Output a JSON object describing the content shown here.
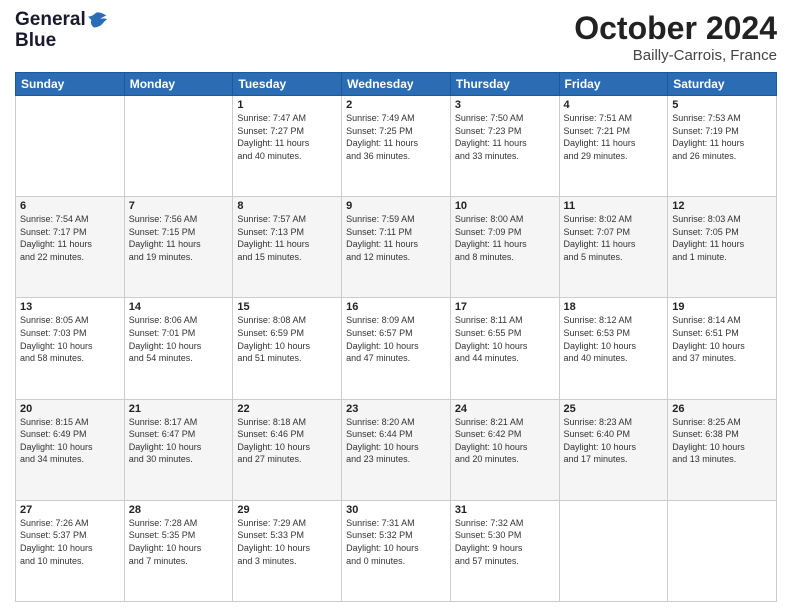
{
  "header": {
    "logo_line1": "General",
    "logo_line2": "Blue",
    "title": "October 2024",
    "location": "Bailly-Carrois, France"
  },
  "weekdays": [
    "Sunday",
    "Monday",
    "Tuesday",
    "Wednesday",
    "Thursday",
    "Friday",
    "Saturday"
  ],
  "weeks": [
    [
      {
        "day": "",
        "info": ""
      },
      {
        "day": "",
        "info": ""
      },
      {
        "day": "1",
        "info": "Sunrise: 7:47 AM\nSunset: 7:27 PM\nDaylight: 11 hours\nand 40 minutes."
      },
      {
        "day": "2",
        "info": "Sunrise: 7:49 AM\nSunset: 7:25 PM\nDaylight: 11 hours\nand 36 minutes."
      },
      {
        "day": "3",
        "info": "Sunrise: 7:50 AM\nSunset: 7:23 PM\nDaylight: 11 hours\nand 33 minutes."
      },
      {
        "day": "4",
        "info": "Sunrise: 7:51 AM\nSunset: 7:21 PM\nDaylight: 11 hours\nand 29 minutes."
      },
      {
        "day": "5",
        "info": "Sunrise: 7:53 AM\nSunset: 7:19 PM\nDaylight: 11 hours\nand 26 minutes."
      }
    ],
    [
      {
        "day": "6",
        "info": "Sunrise: 7:54 AM\nSunset: 7:17 PM\nDaylight: 11 hours\nand 22 minutes."
      },
      {
        "day": "7",
        "info": "Sunrise: 7:56 AM\nSunset: 7:15 PM\nDaylight: 11 hours\nand 19 minutes."
      },
      {
        "day": "8",
        "info": "Sunrise: 7:57 AM\nSunset: 7:13 PM\nDaylight: 11 hours\nand 15 minutes."
      },
      {
        "day": "9",
        "info": "Sunrise: 7:59 AM\nSunset: 7:11 PM\nDaylight: 11 hours\nand 12 minutes."
      },
      {
        "day": "10",
        "info": "Sunrise: 8:00 AM\nSunset: 7:09 PM\nDaylight: 11 hours\nand 8 minutes."
      },
      {
        "day": "11",
        "info": "Sunrise: 8:02 AM\nSunset: 7:07 PM\nDaylight: 11 hours\nand 5 minutes."
      },
      {
        "day": "12",
        "info": "Sunrise: 8:03 AM\nSunset: 7:05 PM\nDaylight: 11 hours\nand 1 minute."
      }
    ],
    [
      {
        "day": "13",
        "info": "Sunrise: 8:05 AM\nSunset: 7:03 PM\nDaylight: 10 hours\nand 58 minutes."
      },
      {
        "day": "14",
        "info": "Sunrise: 8:06 AM\nSunset: 7:01 PM\nDaylight: 10 hours\nand 54 minutes."
      },
      {
        "day": "15",
        "info": "Sunrise: 8:08 AM\nSunset: 6:59 PM\nDaylight: 10 hours\nand 51 minutes."
      },
      {
        "day": "16",
        "info": "Sunrise: 8:09 AM\nSunset: 6:57 PM\nDaylight: 10 hours\nand 47 minutes."
      },
      {
        "day": "17",
        "info": "Sunrise: 8:11 AM\nSunset: 6:55 PM\nDaylight: 10 hours\nand 44 minutes."
      },
      {
        "day": "18",
        "info": "Sunrise: 8:12 AM\nSunset: 6:53 PM\nDaylight: 10 hours\nand 40 minutes."
      },
      {
        "day": "19",
        "info": "Sunrise: 8:14 AM\nSunset: 6:51 PM\nDaylight: 10 hours\nand 37 minutes."
      }
    ],
    [
      {
        "day": "20",
        "info": "Sunrise: 8:15 AM\nSunset: 6:49 PM\nDaylight: 10 hours\nand 34 minutes."
      },
      {
        "day": "21",
        "info": "Sunrise: 8:17 AM\nSunset: 6:47 PM\nDaylight: 10 hours\nand 30 minutes."
      },
      {
        "day": "22",
        "info": "Sunrise: 8:18 AM\nSunset: 6:46 PM\nDaylight: 10 hours\nand 27 minutes."
      },
      {
        "day": "23",
        "info": "Sunrise: 8:20 AM\nSunset: 6:44 PM\nDaylight: 10 hours\nand 23 minutes."
      },
      {
        "day": "24",
        "info": "Sunrise: 8:21 AM\nSunset: 6:42 PM\nDaylight: 10 hours\nand 20 minutes."
      },
      {
        "day": "25",
        "info": "Sunrise: 8:23 AM\nSunset: 6:40 PM\nDaylight: 10 hours\nand 17 minutes."
      },
      {
        "day": "26",
        "info": "Sunrise: 8:25 AM\nSunset: 6:38 PM\nDaylight: 10 hours\nand 13 minutes."
      }
    ],
    [
      {
        "day": "27",
        "info": "Sunrise: 7:26 AM\nSunset: 5:37 PM\nDaylight: 10 hours\nand 10 minutes."
      },
      {
        "day": "28",
        "info": "Sunrise: 7:28 AM\nSunset: 5:35 PM\nDaylight: 10 hours\nand 7 minutes."
      },
      {
        "day": "29",
        "info": "Sunrise: 7:29 AM\nSunset: 5:33 PM\nDaylight: 10 hours\nand 3 minutes."
      },
      {
        "day": "30",
        "info": "Sunrise: 7:31 AM\nSunset: 5:32 PM\nDaylight: 10 hours\nand 0 minutes."
      },
      {
        "day": "31",
        "info": "Sunrise: 7:32 AM\nSunset: 5:30 PM\nDaylight: 9 hours\nand 57 minutes."
      },
      {
        "day": "",
        "info": ""
      },
      {
        "day": "",
        "info": ""
      }
    ]
  ]
}
